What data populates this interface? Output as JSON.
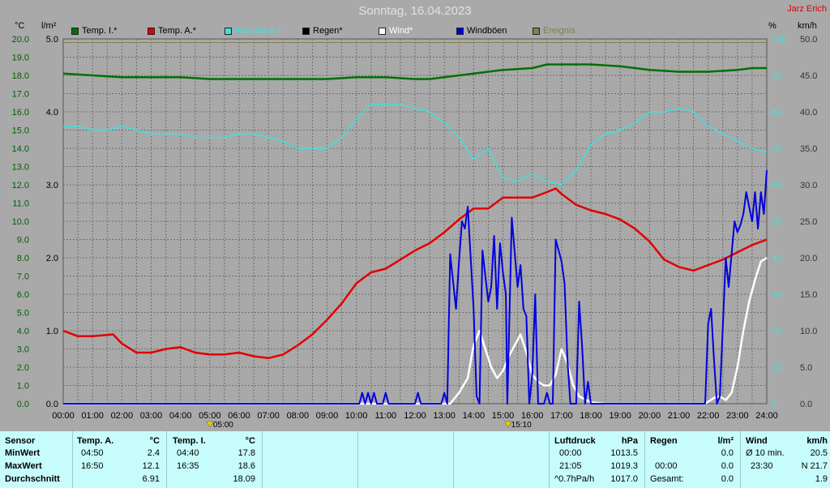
{
  "title": "Sonntag, 16.04.2023",
  "author": "Jarz Erich",
  "axis_units": {
    "temp": "°C",
    "rain": "l/m²",
    "humidity": "%",
    "wind": "km/h"
  },
  "legend": [
    {
      "label": "Temp. I.*",
      "color": "#007000"
    },
    {
      "label": "Temp. A.*",
      "color": "#e00000"
    },
    {
      "label": "Feuchte A.*",
      "color": "#40e0e0"
    },
    {
      "label": "Regen*",
      "color": "#000000"
    },
    {
      "label": "Wind*",
      "color": "#ffffff"
    },
    {
      "label": "Windböen",
      "color": "#0000e0"
    },
    {
      "label": "Ereignis",
      "color": "#808050"
    }
  ],
  "markers": [
    {
      "label": "05:00"
    },
    {
      "label": "15:10"
    }
  ],
  "chart_data": {
    "type": "line",
    "x_label": "hour",
    "xlim": [
      0,
      24
    ],
    "x_tick_labels": [
      "00:00",
      "01:00",
      "02:00",
      "03:00",
      "04:00",
      "05:00",
      "06:00",
      "07:00",
      "08:00",
      "09:00",
      "10:00",
      "11:00",
      "12:00",
      "13:00",
      "14:00",
      "15:00",
      "16:00",
      "17:00",
      "18:00",
      "19:00",
      "20:00",
      "21:00",
      "22:00",
      "23:00",
      "24:00"
    ],
    "axes": {
      "temp": {
        "unit": "°C",
        "lim": [
          0,
          20
        ],
        "ticks": [
          "0.0",
          "1.0",
          "2.0",
          "3.0",
          "4.0",
          "5.0",
          "6.0",
          "7.0",
          "8.0",
          "9.0",
          "10.0",
          "11.0",
          "12.0",
          "13.0",
          "14.0",
          "15.0",
          "16.0",
          "17.0",
          "18.0",
          "19.0",
          "20.0"
        ]
      },
      "rain": {
        "unit": "l/m²",
        "lim": [
          0,
          5
        ],
        "ticks": [
          "0.0",
          "1.0",
          "2.0",
          "3.0",
          "4.0",
          "5.0"
        ]
      },
      "humidity": {
        "unit": "%",
        "lim": [
          0,
          100
        ],
        "ticks": [
          "0",
          "10",
          "20",
          "30",
          "40",
          "50",
          "60",
          "70",
          "80",
          "90",
          "100"
        ]
      },
      "wind": {
        "unit": "km/h",
        "lim": [
          0,
          50
        ],
        "ticks": [
          "0.0",
          "5.0",
          "10.0",
          "15.0",
          "20.0",
          "25.0",
          "30.0",
          "35.0",
          "40.0",
          "45.0",
          "50.0"
        ]
      }
    },
    "grid": true,
    "series": [
      {
        "name": "Temp. I.*",
        "axis": "temp",
        "color": "#007000",
        "x": [
          0,
          1,
          2,
          3,
          4,
          5,
          6,
          7,
          8,
          9,
          10,
          11,
          12,
          12.5,
          13,
          14,
          15,
          16,
          16.5,
          17,
          18,
          19,
          20,
          21,
          22,
          23,
          23.5,
          24
        ],
        "y": [
          18.1,
          18.0,
          17.9,
          17.9,
          17.9,
          17.8,
          17.8,
          17.8,
          17.8,
          17.8,
          17.9,
          17.9,
          17.8,
          17.8,
          17.9,
          18.1,
          18.3,
          18.4,
          18.6,
          18.6,
          18.6,
          18.5,
          18.3,
          18.2,
          18.2,
          18.3,
          18.4,
          18.4
        ]
      },
      {
        "name": "Temp. A.*",
        "axis": "temp",
        "color": "#e00000",
        "x": [
          0,
          0.5,
          1,
          1.7,
          2,
          2.5,
          3,
          3.5,
          4,
          4.5,
          5,
          5.5,
          6,
          6.5,
          7,
          7.5,
          8,
          8.5,
          9,
          9.5,
          10,
          10.5,
          11,
          11.5,
          12,
          12.5,
          13,
          13.5,
          14,
          14.5,
          15,
          15.5,
          16,
          16.5,
          16.8,
          17,
          17.5,
          18,
          18.5,
          19,
          19.5,
          20,
          20.5,
          21,
          21.5,
          22,
          22.5,
          23,
          23.5,
          24
        ],
        "y": [
          4.0,
          3.7,
          3.7,
          3.8,
          3.3,
          2.8,
          2.8,
          3.0,
          3.1,
          2.8,
          2.7,
          2.7,
          2.8,
          2.6,
          2.5,
          2.7,
          3.2,
          3.8,
          4.6,
          5.5,
          6.6,
          7.2,
          7.4,
          7.9,
          8.4,
          8.8,
          9.4,
          10.1,
          10.7,
          10.7,
          11.3,
          11.3,
          11.3,
          11.6,
          11.8,
          11.5,
          10.9,
          10.6,
          10.4,
          10.1,
          9.6,
          8.9,
          7.9,
          7.5,
          7.3,
          7.6,
          7.9,
          8.3,
          8.7,
          9.0
        ]
      },
      {
        "name": "Feuchte A.*",
        "axis": "humidity",
        "color": "#40e0e0",
        "x": [
          0,
          0.5,
          1,
          1.5,
          2,
          2.5,
          3,
          3.5,
          4,
          4.5,
          5,
          5.5,
          6,
          6.5,
          7,
          7.5,
          8,
          8.5,
          9,
          9.5,
          10,
          10.5,
          11,
          11.5,
          12,
          12.5,
          13,
          13.5,
          14,
          14.5,
          15,
          15.5,
          16,
          16.5,
          17,
          17.5,
          18,
          18.5,
          19,
          19.5,
          20,
          20.5,
          21,
          21.5,
          22,
          22.5,
          23,
          23.5,
          24
        ],
        "y": [
          76,
          76,
          75,
          75,
          76,
          75,
          74,
          74,
          74,
          73,
          73,
          73,
          74,
          74,
          73,
          72,
          70,
          70,
          70,
          73,
          78,
          82,
          82,
          82,
          81,
          80,
          77,
          73,
          67,
          70,
          62,
          61,
          63,
          61,
          60,
          64,
          71,
          74,
          75,
          77,
          80,
          80,
          81,
          80,
          76,
          74,
          72,
          70,
          69
        ]
      },
      {
        "name": "Wind*",
        "axis": "wind",
        "color": "#ffffff",
        "x": [
          0,
          13.2,
          13.5,
          13.8,
          14,
          14.2,
          14.4,
          14.6,
          14.8,
          15,
          15.2,
          15.4,
          15.6,
          15.8,
          16,
          16.2,
          16.4,
          16.6,
          16.8,
          17,
          17.2,
          17.4,
          17.6,
          18,
          18.5,
          21.9,
          22.2,
          22.4,
          22.6,
          22.8,
          23,
          23.2,
          23.4,
          23.6,
          23.8,
          24
        ],
        "y": [
          0,
          0,
          1.5,
          3.5,
          8,
          10,
          7.5,
          5,
          3.5,
          4.5,
          6.5,
          8,
          9.5,
          7,
          4,
          3,
          2.5,
          2.5,
          4,
          7.5,
          5.5,
          2.5,
          1.0,
          0.2,
          0,
          0,
          0.8,
          1.0,
          0.5,
          1.5,
          5,
          10,
          14,
          17,
          19.5,
          20
        ]
      },
      {
        "name": "Windböen",
        "axis": "wind",
        "color": "#0000e0",
        "x": [
          0,
          10.1,
          10.2,
          10.3,
          10.4,
          10.5,
          10.6,
          10.7,
          10.8,
          10.9,
          11.0,
          11.1,
          11.2,
          12.0,
          12.1,
          12.2,
          12.9,
          13.0,
          13.1,
          13.2,
          13.4,
          13.5,
          13.6,
          13.7,
          13.8,
          13.9,
          14.0,
          14.1,
          14.2,
          14.3,
          14.5,
          14.6,
          14.7,
          14.8,
          14.9,
          15.0,
          15.1,
          15.15,
          15.3,
          15.5,
          15.6,
          15.7,
          15.8,
          15.9,
          16.0,
          16.1,
          16.2,
          16.4,
          16.5,
          16.6,
          16.7,
          16.8,
          17.0,
          17.1,
          17.2,
          17.3,
          17.5,
          17.6,
          17.7,
          17.8,
          17.9,
          18.0,
          21.8,
          21.9,
          22.0,
          22.1,
          22.2,
          22.3,
          22.4,
          22.6,
          22.7,
          22.9,
          23.0,
          23.1,
          23.2,
          23.3,
          23.4,
          23.5,
          23.6,
          23.7,
          23.8,
          23.9,
          24.0
        ],
        "y": [
          0,
          0,
          1.5,
          0,
          1.5,
          0,
          1.5,
          0,
          0,
          0,
          1.5,
          0,
          0,
          0,
          1.5,
          0,
          0,
          1.5,
          0,
          20.5,
          13,
          19.5,
          25,
          24,
          27,
          20,
          13,
          1,
          0,
          21,
          14,
          16,
          23,
          13,
          22,
          18,
          15,
          0,
          25.5,
          16,
          19,
          13,
          12,
          0,
          4,
          15,
          0,
          0,
          1.5,
          0,
          0,
          22.5,
          19.5,
          16.5,
          6,
          0,
          0,
          14,
          8,
          0,
          3,
          0,
          0,
          0,
          11,
          13,
          6,
          0,
          1,
          20,
          16,
          25,
          23.5,
          24.5,
          26,
          29,
          27,
          25,
          29,
          24,
          29,
          26,
          32
        ]
      },
      {
        "name": "Ereignis",
        "axis": "humidity",
        "color": "#808050",
        "x": [
          0,
          24
        ],
        "y": [
          99,
          99
        ]
      }
    ]
  },
  "stats": {
    "headers": {
      "sensor": "Sensor",
      "temp_a": "Temp. A.",
      "temp_a_unit": "°C",
      "temp_i": "Temp. I.",
      "temp_i_unit": "°C",
      "pressure": "Luftdruck",
      "pressure_unit": "hPa",
      "rain": "Regen",
      "rain_unit": "l/m²",
      "wind": "Wind",
      "wind_unit": "km/h"
    },
    "rows": {
      "min": "MinWert",
      "max": "MaxWert",
      "avg": "Durchschnitt"
    },
    "temp_a": {
      "min_time": "04:50",
      "min": "2.4",
      "max_time": "16:50",
      "max": "12.1",
      "avg": "6.91"
    },
    "temp_i": {
      "min_time": "04:40",
      "min": "17.8",
      "max_time": "16:35",
      "max": "18.6",
      "avg": "18.09"
    },
    "pressure": {
      "r1_time": "00:00",
      "r1": "1013.5",
      "r2_time": "21:05",
      "r2": "1019.3",
      "r3_label": "^0.7hPa/h",
      "r3": "1017.0"
    },
    "rain": {
      "r2_time": "00:00",
      "r2": "0.0",
      "r3_label": "Gesamt:",
      "r3": "0.0",
      "r1": "0.0"
    },
    "wind": {
      "r1_label": "Ø 10 min.",
      "r1": "20.5",
      "r2_time": "23:30",
      "r2": "N 21.7",
      "r3": "1.9"
    }
  }
}
